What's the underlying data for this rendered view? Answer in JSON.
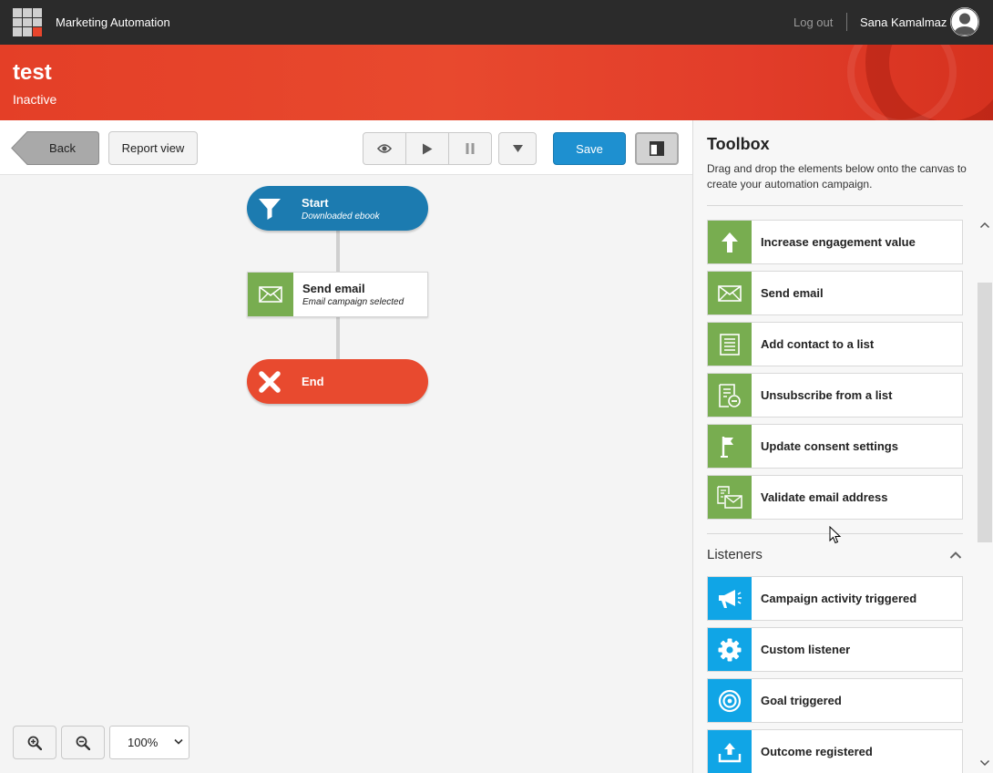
{
  "topbar": {
    "app_title": "Marketing Automation",
    "logout_label": "Log out",
    "user_name": "Sana Kamalmaz"
  },
  "header": {
    "title": "test",
    "status": "Inactive"
  },
  "toolbar": {
    "back_label": "Back",
    "report_view_label": "Report view",
    "save_label": "Save"
  },
  "canvas": {
    "nodes": [
      {
        "title": "Start",
        "subtitle": "Downloaded ebook",
        "icon": "funnel-icon"
      },
      {
        "title": "Send email",
        "subtitle": "Email campaign selected",
        "icon": "envelope-icon"
      },
      {
        "title": "End",
        "subtitle": "",
        "icon": "close-icon"
      }
    ],
    "zoom": "100%"
  },
  "toolbox": {
    "title": "Toolbox",
    "description": "Drag and drop the elements below onto the canvas to create your automation campaign.",
    "actions": [
      {
        "label": "Increase engagement value",
        "icon": "arrow-up-icon"
      },
      {
        "label": "Send email",
        "icon": "envelope-icon"
      },
      {
        "label": "Add contact to a list",
        "icon": "list-icon"
      },
      {
        "label": "Unsubscribe from a list",
        "icon": "unsubscribe-list-icon"
      },
      {
        "label": "Update consent settings",
        "icon": "flag-icon"
      },
      {
        "label": "Validate email address",
        "icon": "validate-email-icon"
      }
    ],
    "listeners_title": "Listeners",
    "listeners": [
      {
        "label": "Campaign activity triggered",
        "icon": "megaphone-icon"
      },
      {
        "label": "Custom listener",
        "icon": "gear-icon"
      },
      {
        "label": "Goal triggered",
        "icon": "target-icon"
      },
      {
        "label": "Outcome registered",
        "icon": "upload-tray-icon"
      }
    ]
  },
  "colors": {
    "header_red": "#e8492e",
    "start_blue": "#1c7bb0",
    "end_red": "#e84a2f",
    "action_green": "#78ad50",
    "listener_blue": "#10a5e6",
    "save_blue": "#1e90d0"
  }
}
